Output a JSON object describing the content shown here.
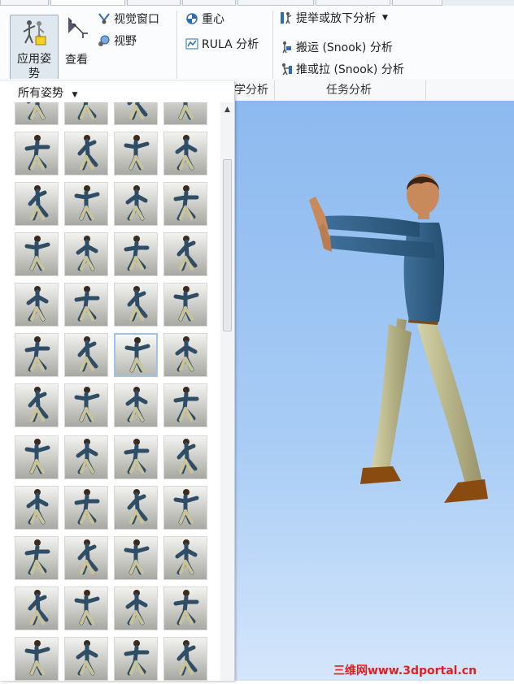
{
  "ribbon": {
    "apply_pose": {
      "line1": "应用姿",
      "line2": "势",
      "icon": "apply-pose-icon"
    },
    "view": {
      "label": "查看",
      "icon": "view-icon"
    },
    "vision_window": {
      "label": "视觉窗口",
      "icon": "vision-window-icon"
    },
    "field_of_view": {
      "label": "视野",
      "icon": "field-of-view-icon"
    },
    "center_of_gravity": {
      "label": "重心",
      "icon": "center-of-gravity-icon"
    },
    "rula": {
      "label": "RULA 分析",
      "icon": "rula-icon"
    },
    "lift_lower": {
      "label": "提举或放下分析",
      "icon": "lift-icon"
    },
    "carry": {
      "label": "搬运 (Snook) 分析",
      "icon": "carry-icon"
    },
    "push_pull": {
      "label": "推或拉 (Snook) 分析",
      "icon": "push-pull-icon"
    },
    "group_labels": {
      "ergonomics_partial": "学分析",
      "task_analysis": "任务分析"
    }
  },
  "pose_panel": {
    "dropdown_label": "所有姿势",
    "selected_index": 22
  },
  "watermark": "三维网www.3dportal.cn",
  "colors": {
    "viewport_top": "#8cb9ef",
    "viewport_bottom": "#d5e6fb",
    "selected_border": "#9ec5e8",
    "watermark": "#e0201c"
  }
}
